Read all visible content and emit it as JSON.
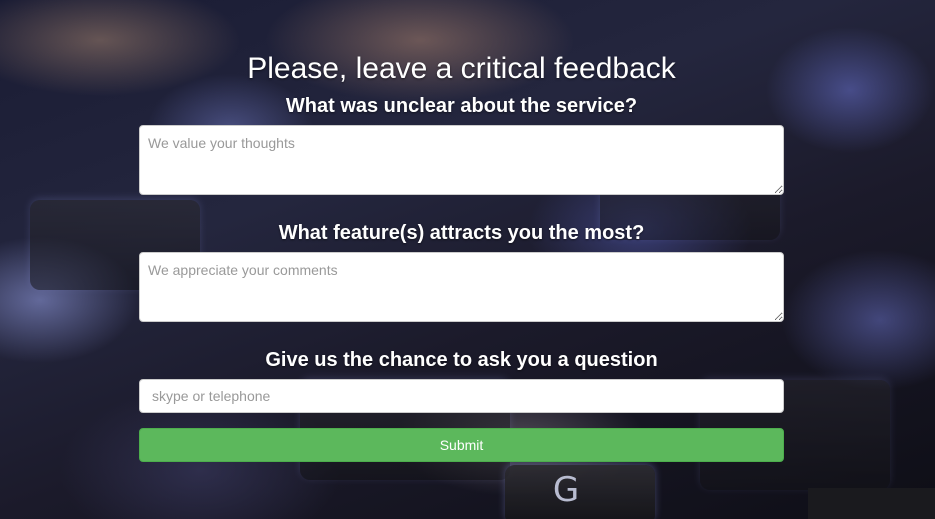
{
  "form": {
    "title": "Please, leave a critical feedback",
    "q1_label": "What was unclear about the service?",
    "q1_placeholder": "We value your thoughts",
    "q2_label": "What feature(s) attracts you the most?",
    "q2_placeholder": "We appreciate your comments",
    "q3_label": "Give us the chance to ask you a question",
    "q3_placeholder": "skype or telephone",
    "submit_label": "Submit"
  },
  "colors": {
    "submit_bg": "#5cb85c",
    "title_text": "#ffffff"
  },
  "background": {
    "description_icon": "keyboard-photo-background"
  }
}
